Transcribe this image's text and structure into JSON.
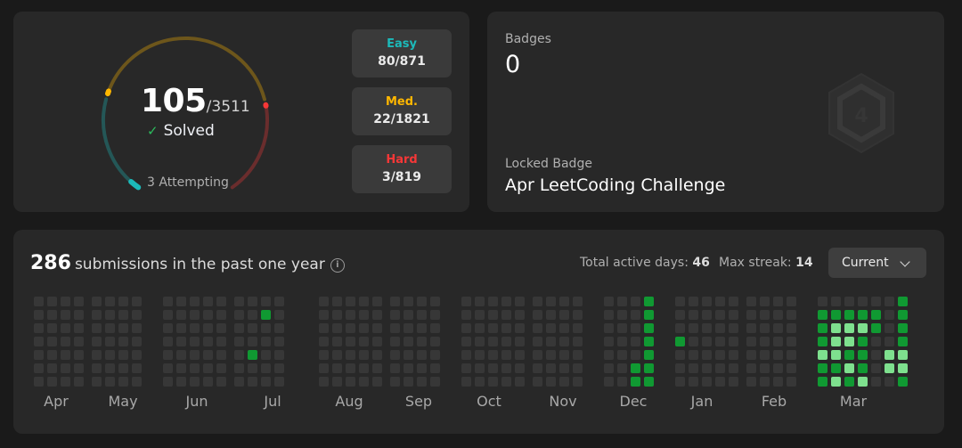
{
  "progress": {
    "solved": "105",
    "total": "/3511",
    "solved_label": "Solved",
    "attempting": "3 Attempting",
    "difficulties": [
      {
        "label": "Easy",
        "value": "80/871",
        "color": "#1cbaba"
      },
      {
        "label": "Med.",
        "value": "22/1821",
        "color": "#ffb700"
      },
      {
        "label": "Hard",
        "value": "3/819",
        "color": "#f63737"
      }
    ]
  },
  "badges": {
    "title": "Badges",
    "count": "0",
    "locked_title": "Locked Badge",
    "locked_name": "Apr LeetCoding Challenge"
  },
  "activity": {
    "submissions_count": "286",
    "submissions_text": "submissions in the past one year",
    "active_days_label": "Total active days:",
    "active_days_value": "46",
    "max_streak_label": "Max streak:",
    "max_streak_value": "14",
    "period": "Current",
    "months": [
      "Apr",
      "May",
      "Jun",
      "Jul",
      "Aug",
      "Sep",
      "Oct",
      "Nov",
      "Dec",
      "Jan",
      "Feb",
      "Mar"
    ],
    "levels": {
      "Jul": [
        [
          1,
          4,
          2
        ],
        [
          2,
          1,
          2
        ]
      ],
      "Dec": [
        [
          3,
          0,
          2
        ],
        [
          3,
          1,
          2
        ],
        [
          3,
          2,
          2
        ],
        [
          3,
          3,
          2
        ],
        [
          3,
          4,
          2
        ],
        [
          2,
          5,
          2
        ],
        [
          3,
          5,
          2
        ],
        [
          2,
          6,
          2
        ],
        [
          3,
          6,
          2
        ],
        [
          3,
          7,
          2
        ]
      ],
      "Jan": [
        [
          0,
          3,
          2
        ]
      ],
      "Mar": [
        [
          0,
          1,
          2
        ],
        [
          1,
          1,
          2
        ],
        [
          2,
          1,
          2
        ],
        [
          3,
          1,
          2
        ],
        [
          4,
          1,
          2
        ],
        [
          0,
          2,
          2
        ],
        [
          1,
          2,
          3
        ],
        [
          2,
          2,
          3
        ],
        [
          3,
          2,
          3
        ],
        [
          4,
          2,
          2
        ],
        [
          0,
          3,
          2
        ],
        [
          1,
          3,
          3
        ],
        [
          2,
          3,
          3
        ],
        [
          3,
          3,
          2
        ],
        [
          0,
          4,
          3
        ],
        [
          1,
          4,
          3
        ],
        [
          2,
          4,
          2
        ],
        [
          3,
          4,
          2
        ],
        [
          0,
          5,
          2
        ],
        [
          1,
          5,
          2
        ],
        [
          2,
          5,
          3
        ],
        [
          3,
          5,
          2
        ],
        [
          0,
          6,
          2
        ],
        [
          1,
          6,
          3
        ],
        [
          2,
          6,
          2
        ],
        [
          3,
          6,
          3
        ],
        [
          1,
          7,
          2
        ],
        [
          2,
          7,
          2
        ],
        [
          3,
          7,
          2
        ],
        [
          -1,
          7,
          2
        ],
        [
          6,
          1,
          2
        ],
        [
          6,
          2,
          2
        ],
        [
          6,
          3,
          2
        ],
        [
          6,
          4,
          3
        ],
        [
          6,
          5,
          3
        ],
        [
          6,
          6,
          2
        ],
        [
          5,
          4,
          3
        ],
        [
          5,
          5,
          3
        ],
        [
          6,
          0,
          2
        ]
      ]
    },
    "level_colors": [
      "#373737",
      "#0e4429",
      "#109932",
      "#7ee08e"
    ]
  }
}
